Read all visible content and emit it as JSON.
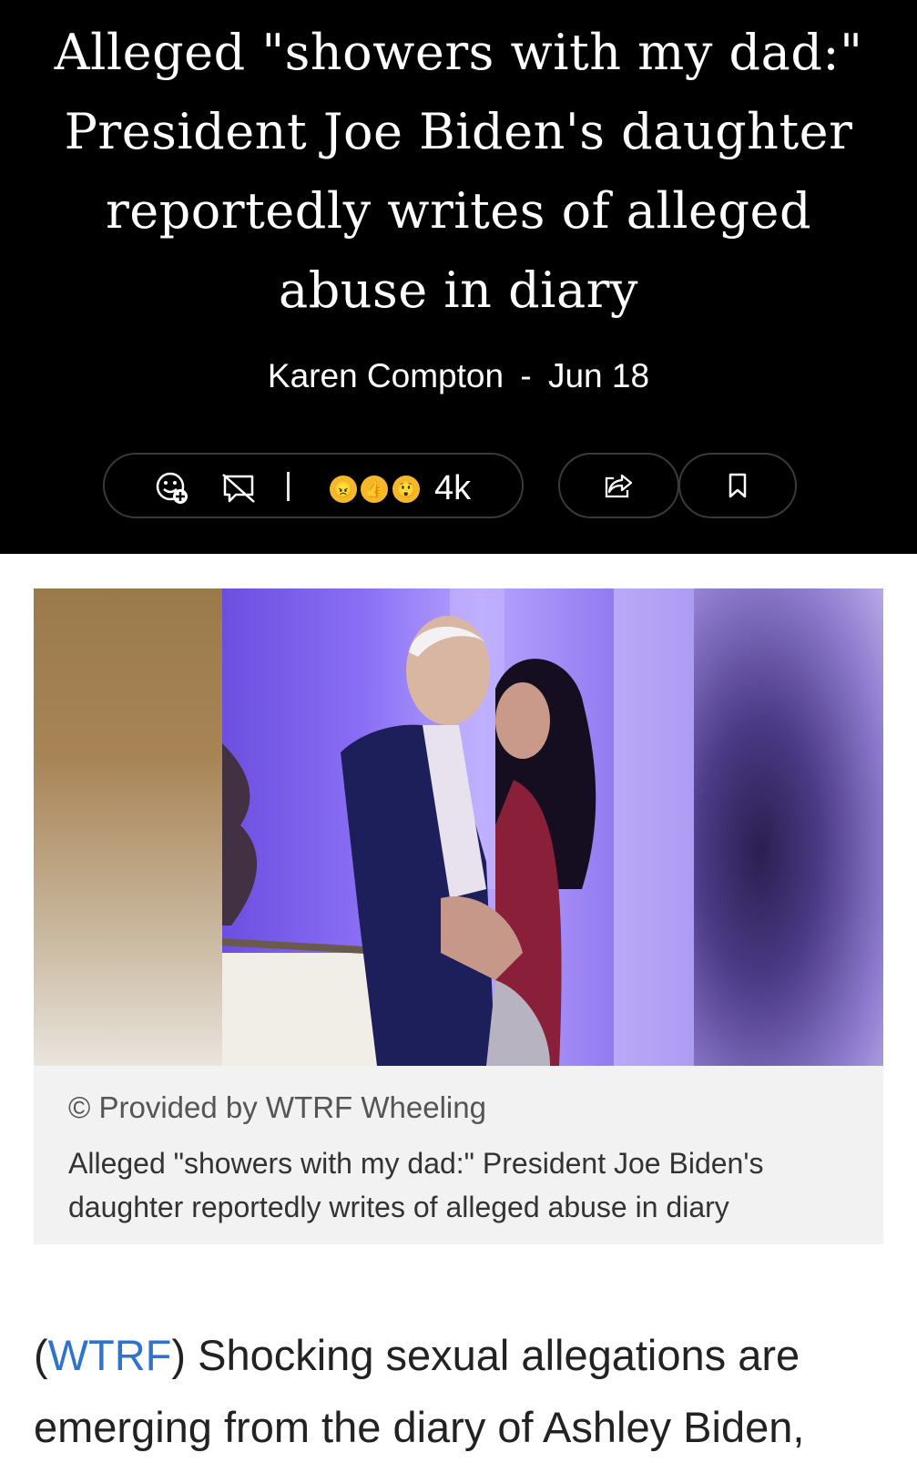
{
  "article": {
    "headline": "Alleged \"showers with my dad:\" President Joe Biden's daughter reportedly writes of alleged abuse in diary",
    "author": "Karen Compton",
    "separator": "-",
    "date": "Jun 18"
  },
  "toolbar": {
    "add_reaction_icon": "add-reaction-icon",
    "comments_off_icon": "comments-off-icon",
    "divider": "|",
    "reactions": [
      "angry",
      "thumbs-up",
      "surprised"
    ],
    "reaction_count": "4k",
    "share_icon": "share-icon",
    "save_icon": "bookmark-icon"
  },
  "image": {
    "provider": "© Provided by WTRF Wheeling",
    "caption": "Alleged \"showers with my dad:\" President Joe Biden's daughter reportedly writes of alleged abuse in diary"
  },
  "body": {
    "open_paren": "(",
    "source_link": "WTRF",
    "close_paren": ")",
    "text": " Shocking sexual allegations are emerging from the diary of Ashley Biden,"
  },
  "colors": {
    "header_bg": "#000000",
    "link": "#2f73cc",
    "caption_bg": "#f2f2f2"
  }
}
